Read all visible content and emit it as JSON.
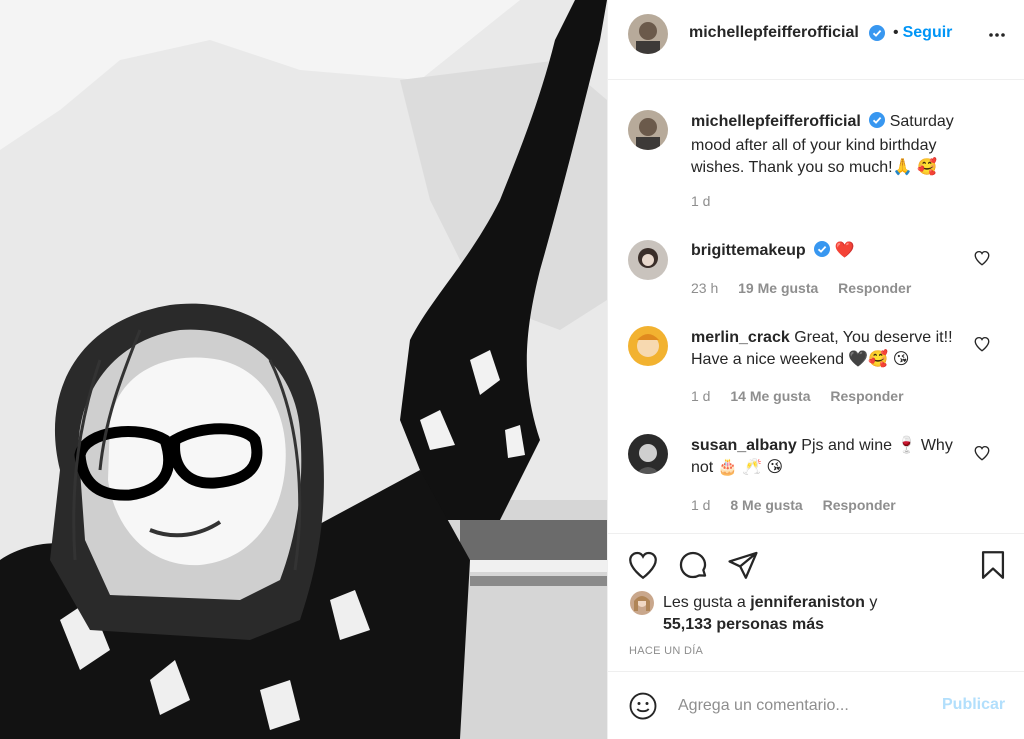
{
  "post": {
    "image_alt": "illustrated selfie of a woman with glasses waving",
    "author": "michellepfeifferofficial",
    "follow_label": "Seguir",
    "follow_separator": "•",
    "caption_text": "Saturday mood after all of your kind birthday wishes. Thank you so much!🙏 🥰",
    "caption_time": "1 d"
  },
  "comments": [
    {
      "user": "brigittemakeup",
      "text": "❤️",
      "time": "23 h",
      "likes": "19 Me gusta",
      "reply": "Responder"
    },
    {
      "user": "merlin_crack",
      "text": "Great, You deserve it!! Have a nice weekend 🖤🥰 😘",
      "time": "1 d",
      "likes": "14 Me gusta",
      "reply": "Responder"
    },
    {
      "user": "susan_albany",
      "text": "Pjs and wine 🍷 Why not 🎂 🥂 😘",
      "time": "1 d",
      "likes": "8 Me gusta",
      "reply": "Responder"
    }
  ],
  "likes": {
    "prefix": "Les gusta a",
    "user": "jenniferaniston",
    "connector": "y",
    "others": "55,133 personas más"
  },
  "posted_ago": "HACE UN DÍA",
  "add_comment": {
    "placeholder": "Agrega un comentario...",
    "publish_label": "Publicar"
  },
  "icons": {
    "verified": "verified-badge-icon",
    "more": "more-options-icon",
    "like": "heart-icon",
    "comment": "comment-bubble-icon",
    "share": "paper-plane-icon",
    "save": "bookmark-icon",
    "emoji": "smiley-icon"
  },
  "colors": {
    "accent": "#0095f6",
    "verified": "#3897f0",
    "publish_disabled": "#b2dffc",
    "muted": "#8e8e8e"
  }
}
